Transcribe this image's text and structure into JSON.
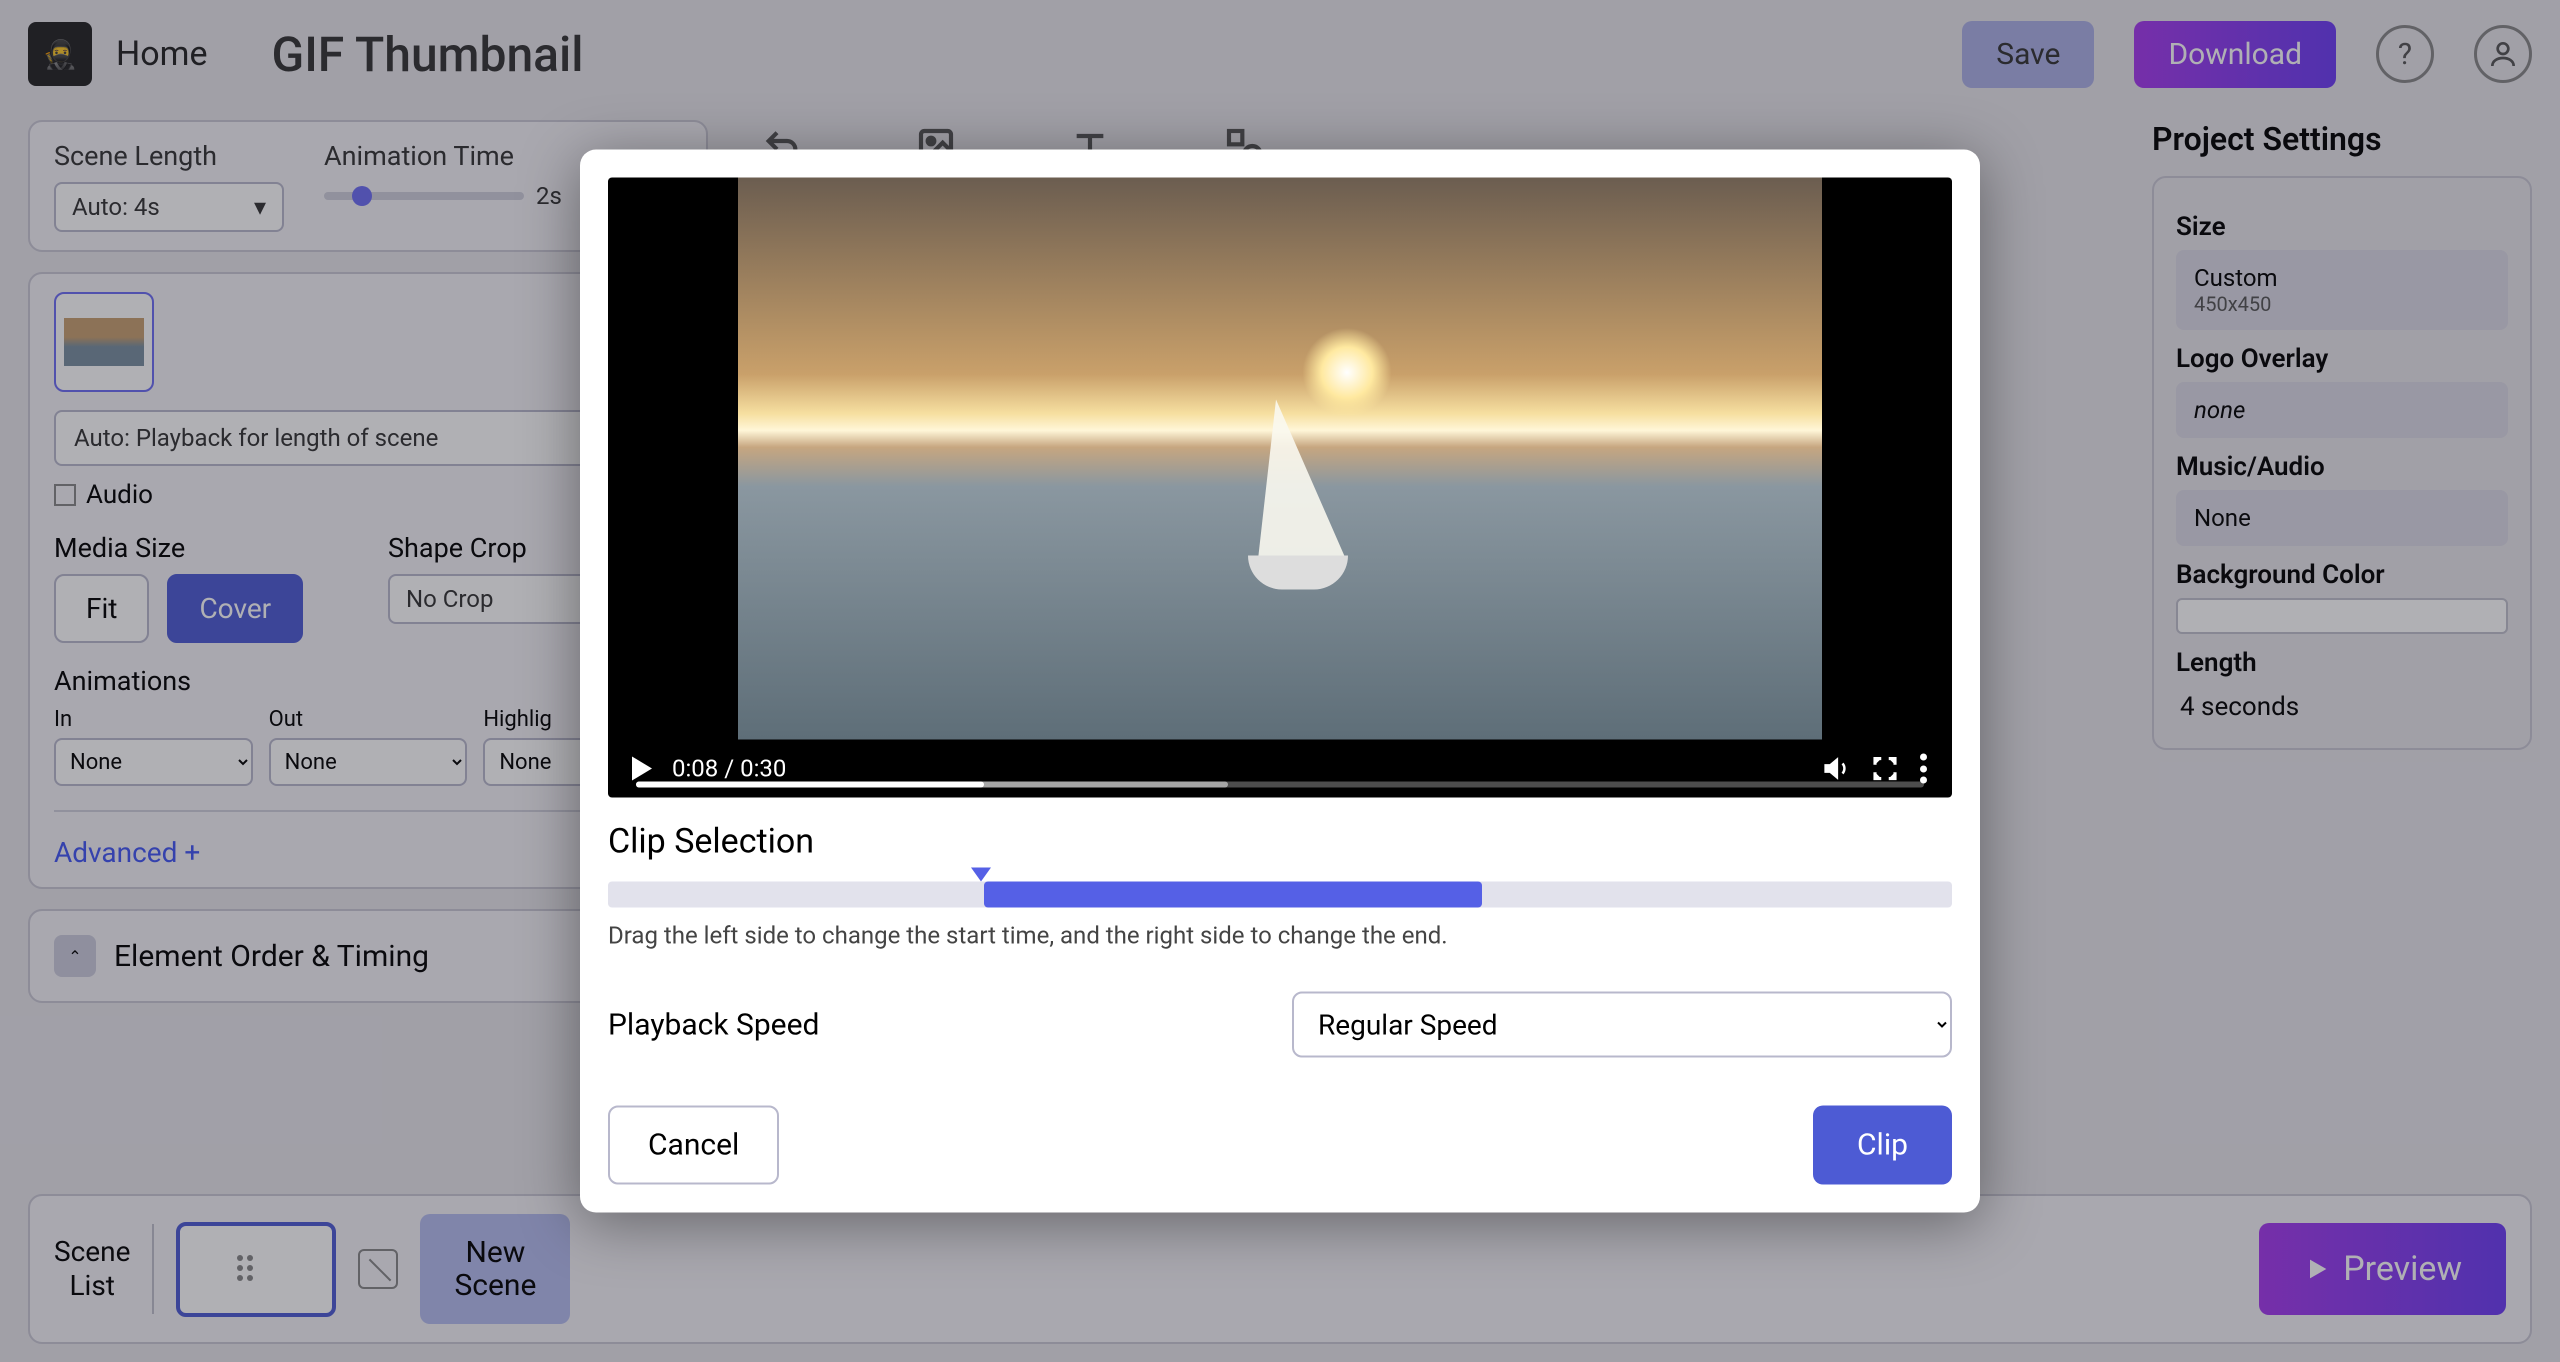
{
  "topbar": {
    "home": "Home",
    "title": "GIF Thumbnail",
    "save": "Save",
    "download": "Download"
  },
  "scene_panel": {
    "scene_length_label": "Scene Length",
    "scene_length_value": "Auto: 4s",
    "animation_time_label": "Animation Time",
    "animation_time_value": "2s",
    "auto_line": "Auto: Playback for length of scene",
    "audio_label": "Audio",
    "media_size_label": "Media Size",
    "fit": "Fit",
    "cover": "Cover",
    "shape_crop_label": "Shape Crop",
    "shape_crop_value": "No Crop",
    "animations_label": "Animations",
    "in_label": "In",
    "out_label": "Out",
    "highlight_label": "Highlig",
    "none": "None",
    "advanced": "Advanced +",
    "element_order": "Element Order & Timing"
  },
  "right": {
    "heading": "Project Settings",
    "size_label": "Size",
    "size_value": "Custom",
    "size_sub": "450x450",
    "logo_label": "Logo Overlay",
    "logo_value": "none",
    "music_label": "Music/Audio",
    "music_value": "None",
    "bg_label": "Background Color",
    "length_label": "Length",
    "length_value": "4 seconds"
  },
  "bottom": {
    "scene_list": "Scene\nList",
    "new_scene": "New\nScene",
    "preview": "Preview"
  },
  "modal": {
    "time": "0:08 / 0:30",
    "clip_selection": "Clip Selection",
    "hint": "Drag the left side to change the start time, and the right side to change the end.",
    "speed_label": "Playback Speed",
    "speed_value": "Regular Speed",
    "cancel": "Cancel",
    "clip": "Clip"
  }
}
